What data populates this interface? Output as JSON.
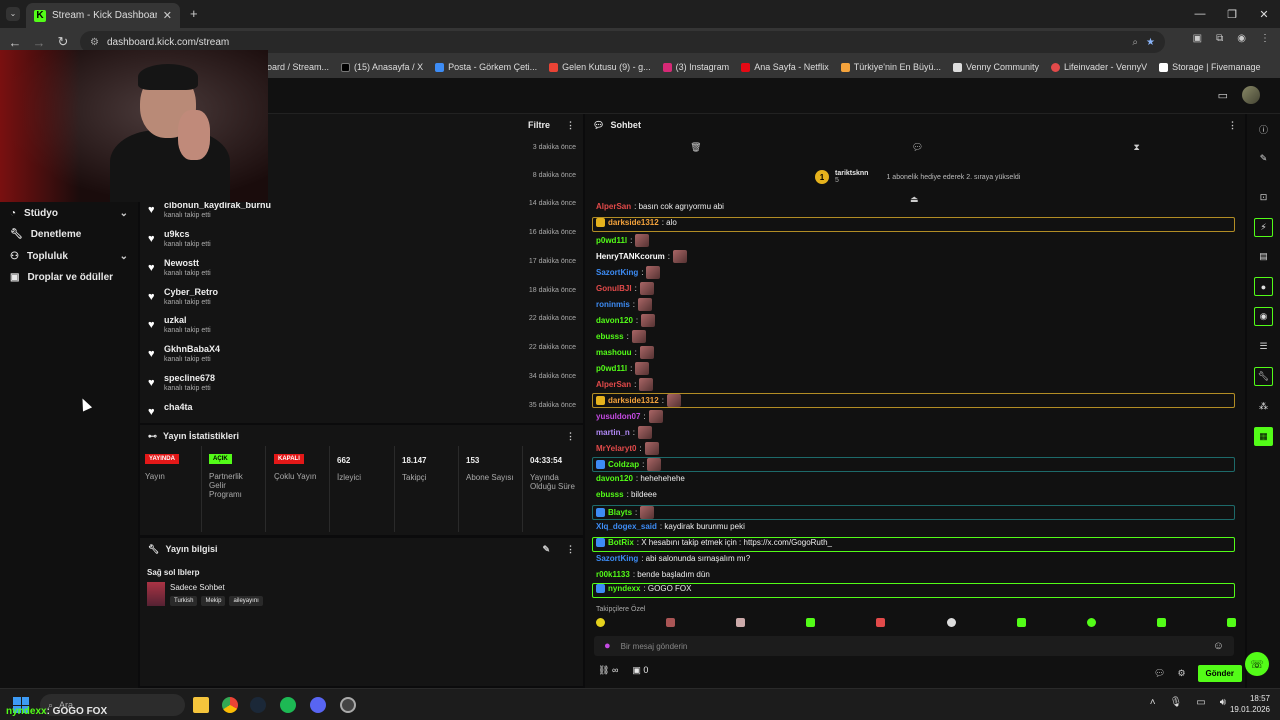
{
  "browser": {
    "tab_title": "Stream - Kick Dashboard",
    "url": "dashboard.kick.com/stream",
    "bookmarks": [
      "board / Stream...",
      "(15) Anasayfa / X",
      "Posta - Görkem Çeti...",
      "Gelen Kutusu (9) - g...",
      "(3) Instagram",
      "Ana Sayfa - Netflix",
      "Türkiye'nin En Büyü...",
      "Venny Community",
      "Lifeinvader - VennyV",
      "Storage | Fivemanage"
    ]
  },
  "sidebar": {
    "items": [
      {
        "label": "Stüdyo",
        "icon": "gauge-icon",
        "chevron": true
      },
      {
        "label": "Denetleme",
        "icon": "wrench-icon",
        "chevron": false
      },
      {
        "label": "Topluluk",
        "icon": "people-icon",
        "chevron": true
      },
      {
        "label": "Droplar ve ödüller",
        "icon": "gift-icon",
        "chevron": false
      }
    ]
  },
  "activity": {
    "filter_label": "Filtre",
    "rows": [
      {
        "name": "",
        "sub": "",
        "time": "3 dakika önce"
      },
      {
        "name": "",
        "sub": "",
        "time": "8 dakika önce"
      },
      {
        "name": "cibonun_kaydirak_burnu",
        "sub": "kanalı takip etti",
        "time": "14 dakika önce"
      },
      {
        "name": "u9kcs",
        "sub": "kanalı takip etti",
        "time": "16 dakika önce"
      },
      {
        "name": "Newostt",
        "sub": "kanalı takip etti",
        "time": "17 dakika önce"
      },
      {
        "name": "Cyber_Retro",
        "sub": "kanalı takip etti",
        "time": "18 dakika önce"
      },
      {
        "name": "uzkal",
        "sub": "kanalı takip etti",
        "time": "22 dakika önce"
      },
      {
        "name": "GkhnBabaX4",
        "sub": "kanalı takip etti",
        "time": "22 dakika önce"
      },
      {
        "name": "specline678",
        "sub": "kanalı takip etti",
        "time": "34 dakika önce"
      },
      {
        "name": "cha4ta",
        "sub": "",
        "time": "35 dakika önce"
      }
    ]
  },
  "stats": {
    "title": "Yayın İstatistikleri",
    "cols": [
      {
        "badge": "YAYINDA",
        "badge_color": "#e31818",
        "label": "Yayın"
      },
      {
        "badge": "AÇIK",
        "badge_color": "#53fc18",
        "label": "Partnerlik Gelir Programı"
      },
      {
        "badge": "KAPALI",
        "badge_color": "#e31818",
        "label": "Çoklu Yayın"
      },
      {
        "value": "662",
        "label": "İzleyici"
      },
      {
        "value": "18.147",
        "label": "Takipçi"
      },
      {
        "value": "153",
        "label": "Abone Sayısı"
      },
      {
        "value": "04:33:54",
        "label": "Yayında Olduğu Süre"
      }
    ]
  },
  "stream_info": {
    "title": "Yayın bilgisi",
    "stream_title": "Sağ sol Iblerp",
    "category": "Sadece Sohbet",
    "tags": [
      "Turkish",
      "Mekip",
      "aileyayını"
    ]
  },
  "chat": {
    "title": "Sohbet",
    "pinned_user": "tariktsknn",
    "pinned_count": "5",
    "pinned_text": "1 abonelik hediye ederek 2. sıraya yükseldi",
    "messages": [
      {
        "user": "AlperSan",
        "color": "#e24a4a",
        "text": ": basın cok agrıyormu abi",
        "emote": false,
        "hl": ""
      },
      {
        "user": "darkside1312",
        "color": "#f4a33c",
        "text": ": alo",
        "emote": false,
        "hl": "#b28d25"
      },
      {
        "user": "p0wd11l",
        "color": "#53fc18",
        "text": ":",
        "emote": true,
        "hl": ""
      },
      {
        "user": "HenryTANKcorum",
        "color": "#ffffff",
        "text": ":",
        "emote": true,
        "hl": ""
      },
      {
        "user": "SazortKing",
        "color": "#3d8cf5",
        "text": ":",
        "emote": true,
        "hl": ""
      },
      {
        "user": "GonulBJI",
        "color": "#e24a4a",
        "text": ":",
        "emote": true,
        "hl": ""
      },
      {
        "user": "roninmis",
        "color": "#3d8cf5",
        "text": ":",
        "emote": true,
        "hl": ""
      },
      {
        "user": "davon120",
        "color": "#53fc18",
        "text": ":",
        "emote": true,
        "hl": ""
      },
      {
        "user": "ebusss",
        "color": "#53fc18",
        "text": ":",
        "emote": true,
        "hl": ""
      },
      {
        "user": "mashouu",
        "color": "#53fc18",
        "text": ":",
        "emote": true,
        "hl": ""
      },
      {
        "user": "p0wd11l",
        "color": "#53fc18",
        "text": ":",
        "emote": true,
        "hl": ""
      },
      {
        "user": "AlperSan",
        "color": "#e24a4a",
        "text": ":",
        "emote": true,
        "hl": ""
      },
      {
        "user": "darkside1312",
        "color": "#f4a33c",
        "text": ":",
        "emote": true,
        "hl": "#b28d25"
      },
      {
        "user": "yusuldon07",
        "color": "#c44ae2",
        "text": ":",
        "emote": true,
        "hl": ""
      },
      {
        "user": "martin_n",
        "color": "#b088f5",
        "text": ":",
        "emote": true,
        "hl": ""
      },
      {
        "user": "MrYelaryt0",
        "color": "#e24a4a",
        "text": ":",
        "emote": true,
        "hl": ""
      },
      {
        "user": "Coldzap",
        "color": "#53fc18",
        "text": ":",
        "emote": true,
        "hl": "#1d6a6a"
      },
      {
        "user": "davon120",
        "color": "#53fc18",
        "text": ": hehehehehe",
        "emote": false,
        "hl": ""
      },
      {
        "user": "ebusss",
        "color": "#53fc18",
        "text": ": bildeee",
        "emote": false,
        "hl": ""
      },
      {
        "user": "Blayts",
        "color": "#53fc18",
        "text": ":",
        "emote": true,
        "hl": "#1d6a6a"
      },
      {
        "user": "Xlq_dogex_said",
        "color": "#3d8cf5",
        "text": ": kaydirak burunmu peki",
        "emote": false,
        "hl": ""
      },
      {
        "user": "BotRix",
        "color": "#53fc18",
        "text": ": X hesabını takip etmek için : https://x.com/GogoRuth_",
        "emote": false,
        "hl": "#53fc18"
      },
      {
        "user": "SazortKing",
        "color": "#3d8cf5",
        "text": ": abi salonunda sırnaşalım mı?",
        "emote": false,
        "hl": ""
      },
      {
        "user": "r00k1133",
        "color": "#53fc18",
        "text": ": bende başladım dün",
        "emote": false,
        "hl": ""
      },
      {
        "user": "nyndexx",
        "color": "#53fc18",
        "text": ": GOGO FOX",
        "emote": false,
        "hl": "#53fc18"
      }
    ],
    "followers_only": "Takipçilere Özel",
    "input_placeholder": "Bir mesaj gönderin",
    "points": "∞",
    "count": "0",
    "send_label": "Gönder"
  },
  "taskbar": {
    "search": "Ara",
    "overlay_user": "nyndexx",
    "overlay_msg": ": GOGO FOX",
    "time": "18:57",
    "date": "19.01.2026"
  }
}
